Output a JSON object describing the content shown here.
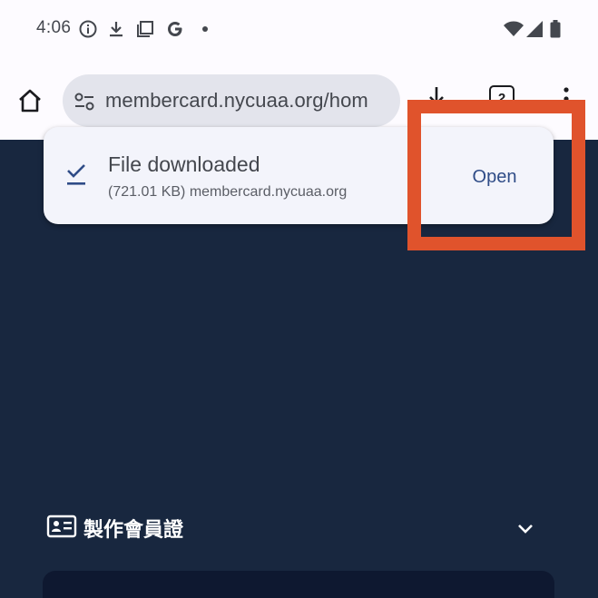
{
  "status_bar": {
    "time": "4:06",
    "left_icons": [
      "info-icon",
      "download-icon",
      "screenshot-icon",
      "google-icon",
      "dot-icon"
    ],
    "right_icons": [
      "wifi-icon",
      "signal-icon",
      "battery-icon"
    ]
  },
  "browser": {
    "url": "membercard.nycuaa.org/hom",
    "buttons": [
      "home-icon",
      "download-icon",
      "tab-switcher-icon",
      "more-options-icon"
    ],
    "tab_count": "2"
  },
  "download_notification": {
    "title": "File downloaded",
    "subtitle": "(721.01 KB) membercard.nycuaa.org",
    "action_label": "Open"
  },
  "section": {
    "title": "製作會員證"
  },
  "colors": {
    "page_background": "#18273f",
    "highlight": "#e0532c",
    "accent": "#2f4c87"
  }
}
